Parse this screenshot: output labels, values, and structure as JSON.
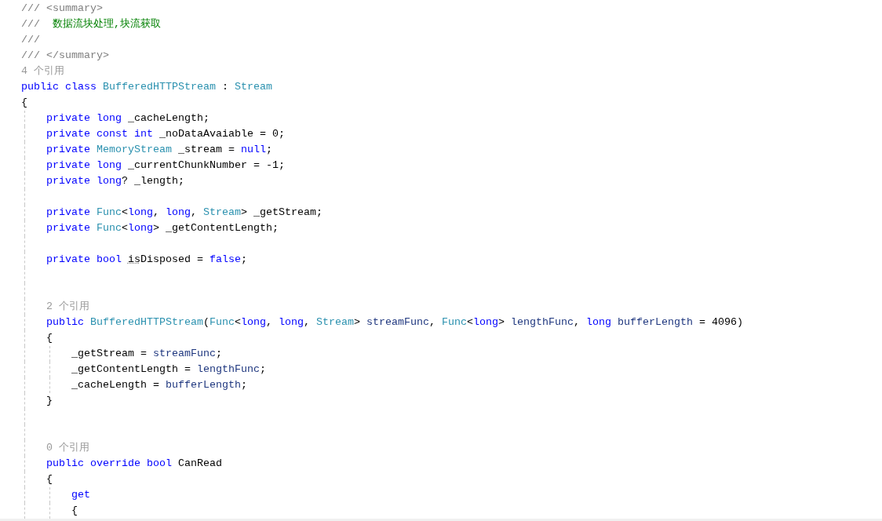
{
  "editor": {
    "lines": [
      {
        "kind": "code",
        "tokens": [
          {
            "text": "/// <summary>",
            "kind": "comment"
          }
        ]
      },
      {
        "kind": "code",
        "tokens": [
          {
            "text": "///  ",
            "kind": "comment"
          },
          {
            "text": "数据流块处理,块流获取",
            "kind": "doc"
          }
        ]
      },
      {
        "kind": "code",
        "tokens": [
          {
            "text": "///",
            "kind": "comment"
          }
        ]
      },
      {
        "kind": "code",
        "tokens": [
          {
            "text": "/// </summary>",
            "kind": "comment"
          }
        ]
      },
      {
        "kind": "lens",
        "tokens": [
          {
            "text": "4 个引用",
            "kind": "lens"
          }
        ]
      },
      {
        "kind": "code",
        "tokens": [
          {
            "text": "public class ",
            "kind": "keyword"
          },
          {
            "text": "BufferedHTTPStream",
            "kind": "type"
          },
          {
            "text": " : ",
            "kind": "plain"
          },
          {
            "text": "Stream",
            "kind": "type"
          }
        ]
      },
      {
        "kind": "code",
        "tokens": [
          {
            "text": "{",
            "kind": "plain"
          }
        ]
      },
      {
        "kind": "code",
        "tokens": [
          {
            "text": "    private long ",
            "kind": "keyword"
          },
          {
            "text": "_cacheLength;",
            "kind": "plain"
          }
        ]
      },
      {
        "kind": "code",
        "tokens": [
          {
            "text": "    private const int ",
            "kind": "keyword"
          },
          {
            "text": "_noDataAvaiable = 0;",
            "kind": "plain"
          }
        ]
      },
      {
        "kind": "code",
        "tokens": [
          {
            "text": "    private ",
            "kind": "keyword"
          },
          {
            "text": "MemoryStream",
            "kind": "type"
          },
          {
            "text": " _stream = ",
            "kind": "plain"
          },
          {
            "text": "null",
            "kind": "keyword"
          },
          {
            "text": ";",
            "kind": "plain"
          }
        ]
      },
      {
        "kind": "code",
        "tokens": [
          {
            "text": "    private long ",
            "kind": "keyword"
          },
          {
            "text": "_currentChunkNumber = -1;",
            "kind": "plain"
          }
        ]
      },
      {
        "kind": "code",
        "tokens": [
          {
            "text": "    private long",
            "kind": "keyword"
          },
          {
            "text": "? _length;",
            "kind": "plain"
          }
        ]
      },
      {
        "kind": "blank"
      },
      {
        "kind": "code",
        "tokens": [
          {
            "text": "    private ",
            "kind": "keyword"
          },
          {
            "text": "Func",
            "kind": "type"
          },
          {
            "text": "<",
            "kind": "plain"
          },
          {
            "text": "long",
            "kind": "keyword"
          },
          {
            "text": ", ",
            "kind": "plain"
          },
          {
            "text": "long",
            "kind": "keyword"
          },
          {
            "text": ", ",
            "kind": "plain"
          },
          {
            "text": "Stream",
            "kind": "type"
          },
          {
            "text": "> _getStream;",
            "kind": "plain"
          }
        ]
      },
      {
        "kind": "code",
        "tokens": [
          {
            "text": "    private ",
            "kind": "keyword"
          },
          {
            "text": "Func",
            "kind": "type"
          },
          {
            "text": "<",
            "kind": "plain"
          },
          {
            "text": "long",
            "kind": "keyword"
          },
          {
            "text": "> _getContentLength;",
            "kind": "plain"
          }
        ]
      },
      {
        "kind": "blank"
      },
      {
        "kind": "code",
        "tokens": [
          {
            "text": "    private bool ",
            "kind": "keyword"
          },
          {
            "text": "is",
            "kind": "hint"
          },
          {
            "text": "Disposed = ",
            "kind": "plain"
          },
          {
            "text": "false",
            "kind": "keyword"
          },
          {
            "text": ";",
            "kind": "plain"
          }
        ]
      },
      {
        "kind": "blank"
      },
      {
        "kind": "blank"
      },
      {
        "kind": "lens",
        "tokens": [
          {
            "text": "    2 个引用",
            "kind": "lens"
          }
        ]
      },
      {
        "kind": "code",
        "tokens": [
          {
            "text": "    public ",
            "kind": "keyword"
          },
          {
            "text": "BufferedHTTPStream",
            "kind": "type"
          },
          {
            "text": "(",
            "kind": "plain"
          },
          {
            "text": "Func",
            "kind": "type"
          },
          {
            "text": "<",
            "kind": "plain"
          },
          {
            "text": "long",
            "kind": "keyword"
          },
          {
            "text": ", ",
            "kind": "plain"
          },
          {
            "text": "long",
            "kind": "keyword"
          },
          {
            "text": ", ",
            "kind": "plain"
          },
          {
            "text": "Stream",
            "kind": "type"
          },
          {
            "text": "> ",
            "kind": "plain"
          },
          {
            "text": "streamFunc",
            "kind": "param"
          },
          {
            "text": ", ",
            "kind": "plain"
          },
          {
            "text": "Func",
            "kind": "type"
          },
          {
            "text": "<",
            "kind": "plain"
          },
          {
            "text": "long",
            "kind": "keyword"
          },
          {
            "text": "> ",
            "kind": "plain"
          },
          {
            "text": "lengthFunc",
            "kind": "param"
          },
          {
            "text": ", ",
            "kind": "plain"
          },
          {
            "text": "long ",
            "kind": "keyword"
          },
          {
            "text": "bufferLength",
            "kind": "param"
          },
          {
            "text": " = 4096)",
            "kind": "plain"
          }
        ]
      },
      {
        "kind": "code",
        "tokens": [
          {
            "text": "    {",
            "kind": "plain"
          }
        ]
      },
      {
        "kind": "code",
        "tokens": [
          {
            "text": "        _getStream = ",
            "kind": "plain"
          },
          {
            "text": "streamFunc",
            "kind": "param"
          },
          {
            "text": ";",
            "kind": "plain"
          }
        ]
      },
      {
        "kind": "code",
        "tokens": [
          {
            "text": "        _getContentLength = ",
            "kind": "plain"
          },
          {
            "text": "lengthFunc",
            "kind": "param"
          },
          {
            "text": ";",
            "kind": "plain"
          }
        ]
      },
      {
        "kind": "code",
        "tokens": [
          {
            "text": "        _cacheLength = ",
            "kind": "plain"
          },
          {
            "text": "bufferLength",
            "kind": "param"
          },
          {
            "text": ";",
            "kind": "plain"
          }
        ]
      },
      {
        "kind": "code",
        "tokens": [
          {
            "text": "    }",
            "kind": "plain"
          }
        ]
      },
      {
        "kind": "blank"
      },
      {
        "kind": "blank"
      },
      {
        "kind": "lens",
        "tokens": [
          {
            "text": "    0 个引用",
            "kind": "lens"
          }
        ]
      },
      {
        "kind": "code",
        "tokens": [
          {
            "text": "    public override bool ",
            "kind": "keyword"
          },
          {
            "text": "CanRead",
            "kind": "plain"
          }
        ]
      },
      {
        "kind": "code",
        "tokens": [
          {
            "text": "    {",
            "kind": "plain"
          }
        ]
      },
      {
        "kind": "code",
        "tokens": [
          {
            "text": "        get",
            "kind": "keyword"
          }
        ]
      },
      {
        "kind": "code",
        "tokens": [
          {
            "text": "        {",
            "kind": "plain"
          }
        ]
      }
    ]
  }
}
